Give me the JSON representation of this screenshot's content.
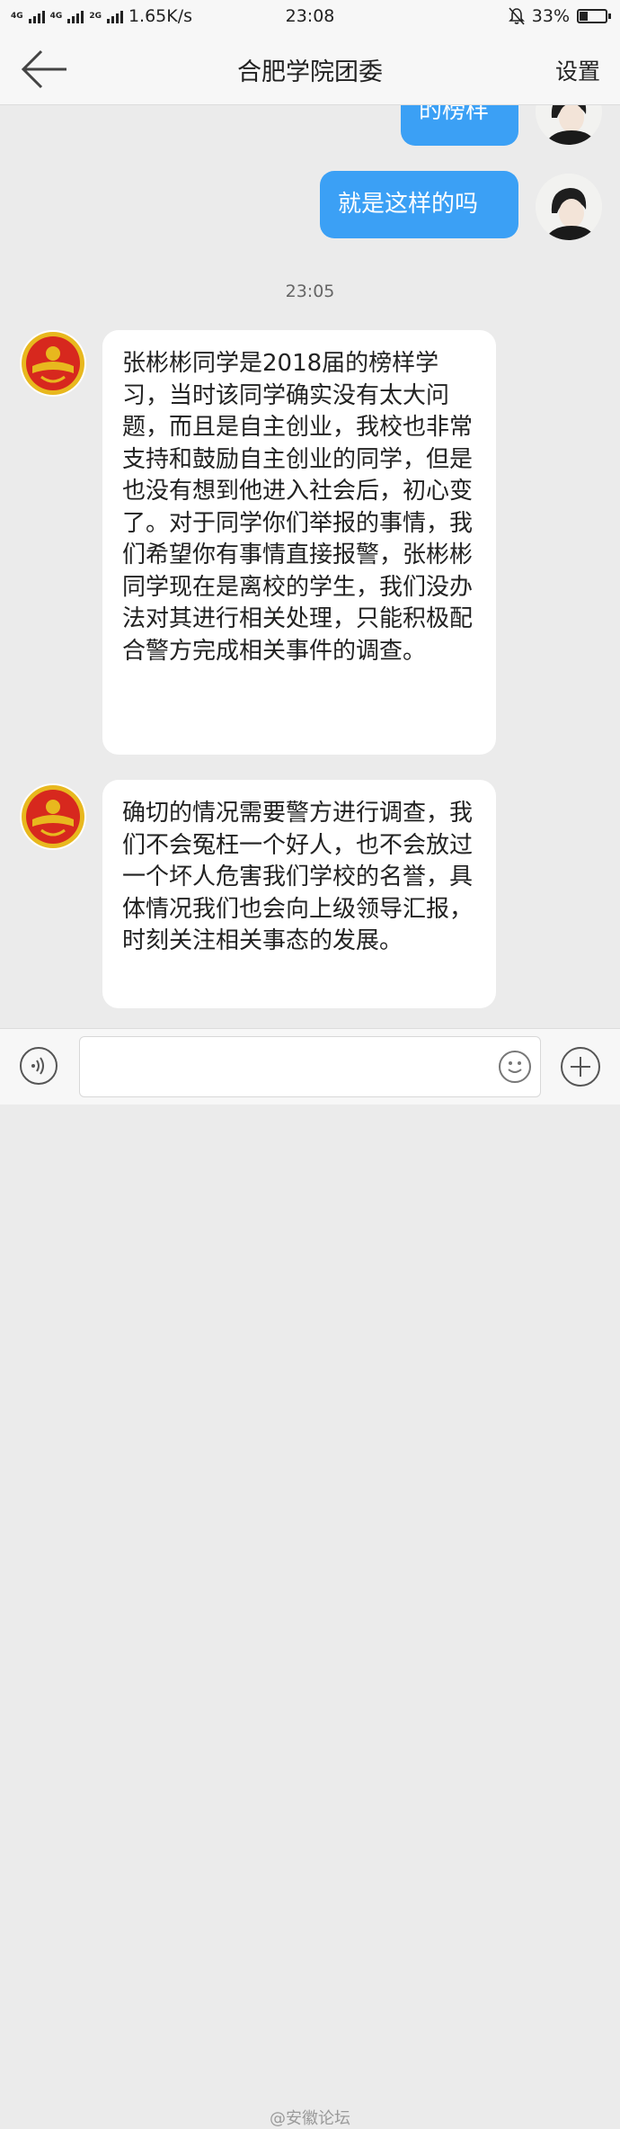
{
  "status_bar": {
    "network_1": "4G",
    "network_2": "4G",
    "network_3": "2G",
    "speed": "1.65K/s",
    "time": "23:08",
    "battery": "33%",
    "battery_level": 0.33
  },
  "header": {
    "title": "合肥学院团委",
    "settings_label": "设置"
  },
  "messages": {
    "outgoing_1": "的榜样",
    "outgoing_2": "就是这样的吗",
    "timestamp": "23:05",
    "incoming_1": "张彬彬同学是2018届的榜样学习，当时该同学确实没有太大问题，而且是自主创业，我校也非常支持和鼓励自主创业的同学，但是也没有想到他进入社会后，初心变了。对于同学你们举报的事情，我们希望你有事情直接报警，张彬彬同学现在是离校的学生，我们没办法对其进行相关处理，只能积极配合警方完成相关事件的调查。",
    "incoming_2": "确切的情况需要警方进行调查，我们不会冤枉一个好人，也不会放过一个坏人危害我们学校的名誉，具体情况我们也会向上级领导汇报，时刻关注相关事态的发展。"
  },
  "input_bar": {
    "placeholder": ""
  },
  "watermark": "@安徽论坛",
  "icons": {
    "back": "arrow-left-icon",
    "voice": "voice-icon",
    "emoji": "emoji-icon",
    "plus": "plus-icon",
    "mute": "bell-off-icon"
  },
  "colors": {
    "outgoing_bubble": "#3ba0f5",
    "incoming_bubble": "#ffffff",
    "background": "#ebebeb",
    "league_emblem_red": "#d7281e",
    "league_emblem_gold": "#e8b81e"
  }
}
